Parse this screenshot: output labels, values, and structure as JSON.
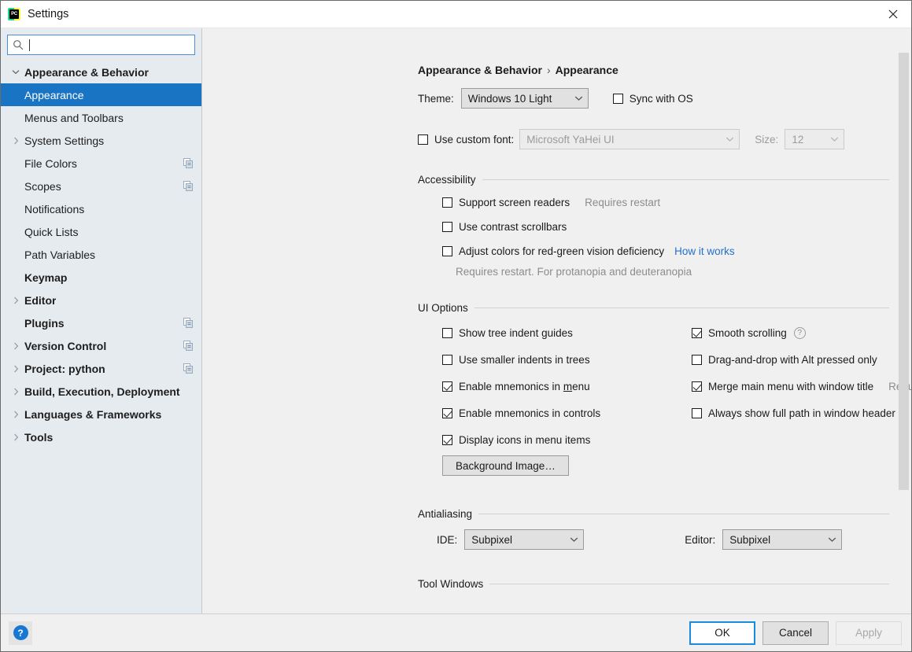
{
  "window": {
    "title": "Settings",
    "app_icon": "pycharm-icon",
    "app_icon_text": "PC",
    "close_icon": "close-icon"
  },
  "sidebar": {
    "search": {
      "value": "",
      "placeholder": "",
      "icon": "search-icon"
    },
    "items": [
      {
        "label": "Appearance & Behavior",
        "indent": 0,
        "bold": true,
        "arrow": "expanded",
        "selected": false,
        "config_icon": false
      },
      {
        "label": "Appearance",
        "indent": 1,
        "bold": false,
        "arrow": "none",
        "selected": true,
        "config_icon": false
      },
      {
        "label": "Menus and Toolbars",
        "indent": 1,
        "bold": false,
        "arrow": "none",
        "selected": false,
        "config_icon": false
      },
      {
        "label": "System Settings",
        "indent": 1,
        "bold": false,
        "arrow": "collapsed",
        "selected": false,
        "config_icon": false
      },
      {
        "label": "File Colors",
        "indent": 1,
        "bold": false,
        "arrow": "none",
        "selected": false,
        "config_icon": true
      },
      {
        "label": "Scopes",
        "indent": 1,
        "bold": false,
        "arrow": "none",
        "selected": false,
        "config_icon": true
      },
      {
        "label": "Notifications",
        "indent": 1,
        "bold": false,
        "arrow": "none",
        "selected": false,
        "config_icon": false
      },
      {
        "label": "Quick Lists",
        "indent": 1,
        "bold": false,
        "arrow": "none",
        "selected": false,
        "config_icon": false
      },
      {
        "label": "Path Variables",
        "indent": 1,
        "bold": false,
        "arrow": "none",
        "selected": false,
        "config_icon": false
      },
      {
        "label": "Keymap",
        "indent": 0,
        "bold": true,
        "arrow": "none",
        "selected": false,
        "config_icon": false
      },
      {
        "label": "Editor",
        "indent": 0,
        "bold": true,
        "arrow": "collapsed",
        "selected": false,
        "config_icon": false
      },
      {
        "label": "Plugins",
        "indent": 0,
        "bold": true,
        "arrow": "none",
        "selected": false,
        "config_icon": true
      },
      {
        "label": "Version Control",
        "indent": 0,
        "bold": true,
        "arrow": "collapsed",
        "selected": false,
        "config_icon": true
      },
      {
        "label": "Project: python",
        "indent": 0,
        "bold": true,
        "arrow": "collapsed",
        "selected": false,
        "config_icon": true
      },
      {
        "label": "Build, Execution, Deployment",
        "indent": 0,
        "bold": true,
        "arrow": "collapsed",
        "selected": false,
        "config_icon": false
      },
      {
        "label": "Languages & Frameworks",
        "indent": 0,
        "bold": true,
        "arrow": "collapsed",
        "selected": false,
        "config_icon": false
      },
      {
        "label": "Tools",
        "indent": 0,
        "bold": true,
        "arrow": "collapsed",
        "selected": false,
        "config_icon": false
      }
    ]
  },
  "breadcrumb": {
    "parent": "Appearance & Behavior",
    "separator": "›",
    "current": "Appearance"
  },
  "theme_row": {
    "label": "Theme:",
    "value": "Windows 10 Light",
    "sync_label": "Sync with OS",
    "sync_checked": false
  },
  "font_row": {
    "checkbox_label": "Use custom font:",
    "checked": false,
    "font_value": "Microsoft YaHei UI",
    "size_label": "Size:",
    "size_value": "12"
  },
  "accessibility": {
    "title": "Accessibility",
    "items": [
      {
        "label": "Support screen readers",
        "checked": false,
        "hint": "Requires restart"
      },
      {
        "label": "Use contrast scrollbars",
        "checked": false,
        "hint": ""
      },
      {
        "label": "Adjust colors for red-green vision deficiency",
        "checked": false,
        "link": "How it works"
      }
    ],
    "note": "Requires restart. For protanopia and deuteranopia"
  },
  "ui_options": {
    "title": "UI Options",
    "left": [
      {
        "label": "Show tree indent guides",
        "checked": false
      },
      {
        "label": "Use smaller indents in trees",
        "checked": false
      },
      {
        "label_pre": "Enable mnemonics in ",
        "mnemonic": "m",
        "label_post": "enu",
        "checked": true
      },
      {
        "label": "Enable mnemonics in controls",
        "checked": true
      },
      {
        "label": "Display icons in menu items",
        "checked": true
      }
    ],
    "right": [
      {
        "label": "Smooth scrolling",
        "checked": true,
        "help_icon": "help-icon",
        "help_glyph": "?"
      },
      {
        "label": "Drag-and-drop with Alt pressed only",
        "checked": false
      },
      {
        "label": "Merge main menu with window title",
        "checked": true,
        "hint": "Requires restart"
      },
      {
        "label": "Always show full path in window header",
        "checked": false
      }
    ],
    "background_image_button": "Background Image…"
  },
  "antialiasing": {
    "title": "Antialiasing",
    "ide_label": "IDE:",
    "ide_value": "Subpixel",
    "editor_label": "Editor:",
    "editor_value": "Subpixel"
  },
  "tool_windows": {
    "title": "Tool Windows"
  },
  "footer": {
    "help_icon": "help-icon",
    "help_glyph": "?",
    "ok": "OK",
    "cancel": "Cancel",
    "apply": "Apply",
    "apply_disabled": true
  },
  "colors": {
    "selection_blue": "#1a74c4",
    "link_blue": "#2470c8",
    "focus_blue": "#1a8ce0",
    "sidebar_bg": "#e6ebef",
    "panel_bg": "#f0f0f0",
    "hint_grey": "#8c8c8c"
  }
}
